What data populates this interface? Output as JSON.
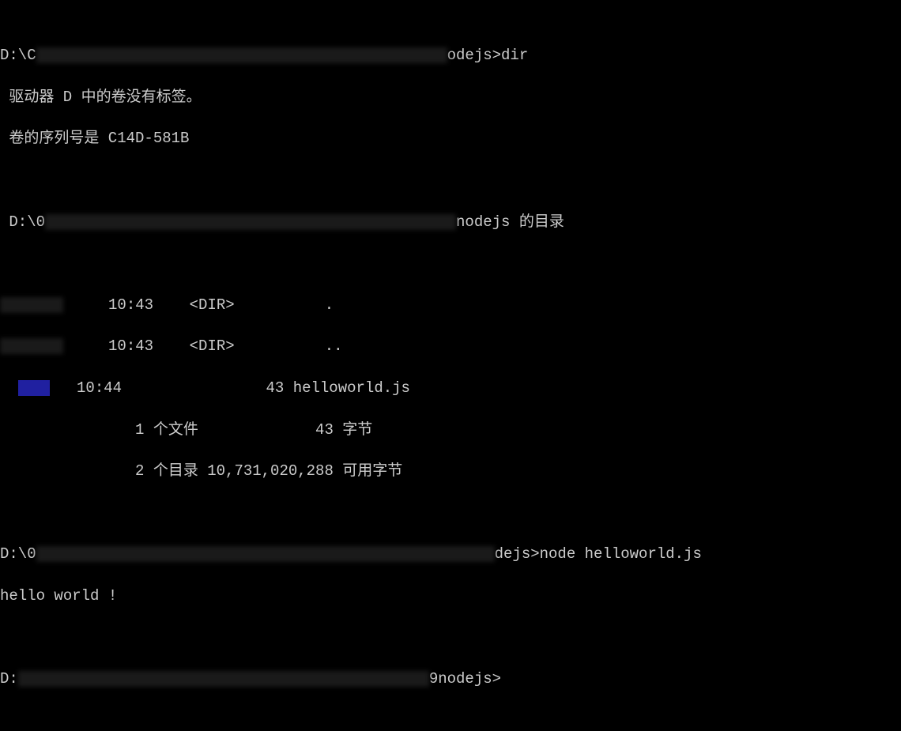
{
  "prompt1": {
    "prefix": "D:\\C",
    "suffix": "odejs>",
    "command": "dir"
  },
  "volume": {
    "line1": " 驱动器 D 中的卷没有标签。",
    "line2": " 卷的序列号是 C14D-581B"
  },
  "dirheader": {
    "prefix": "D:\\0",
    "suffix": "nodejs 的目录"
  },
  "listing": {
    "row1": {
      "time": "10:43",
      "type": "<DIR>",
      "name": "."
    },
    "row2": {
      "time": "10:43",
      "type": "<DIR>",
      "name": ".."
    },
    "row3": {
      "time": "10:44",
      "size": "43",
      "name": "helloworld.js"
    },
    "summary1": "               1 个文件             43 字节",
    "summary2": "               2 个目录 10,731,020,288 可用字节"
  },
  "prompt2": {
    "prefix": "D:\\0",
    "suffix": "dejs>",
    "command": "node helloworld.js"
  },
  "output": "hello world !",
  "prompt3": {
    "prefix": "D:",
    "suffix": "9nodejs>"
  }
}
